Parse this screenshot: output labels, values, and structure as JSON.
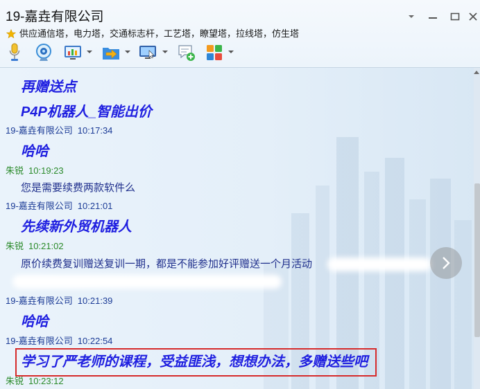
{
  "window": {
    "title": "19-嘉垚有限公司",
    "subtitle": "供应通信塔，电力塔，交通标志杆，工艺塔，瞭望塔，拉线塔，仿生塔",
    "subtitle_icon": "star-icon",
    "controls": [
      "menu-chevron-icon",
      "minimize-icon",
      "maximize-icon",
      "close-icon"
    ]
  },
  "toolbar": {
    "items": [
      {
        "icon": "microphone-icon",
        "dropdown": false
      },
      {
        "icon": "webcam-icon",
        "dropdown": false
      },
      {
        "icon": "screen-share-icon",
        "dropdown": true
      },
      {
        "icon": "file-transfer-icon",
        "dropdown": true
      },
      {
        "icon": "remote-desktop-icon",
        "dropdown": true
      },
      {
        "icon": "add-chat-icon",
        "dropdown": false
      },
      {
        "icon": "apps-grid-icon",
        "dropdown": true
      }
    ]
  },
  "chat": {
    "entries": [
      {
        "type": "message",
        "style": "bold-italic",
        "text": "再赠送点"
      },
      {
        "type": "message",
        "style": "bold-italic",
        "text": "P4P机器人_智能出价"
      },
      {
        "type": "sender",
        "is_self": false,
        "sender": "19-嘉垚有限公司",
        "time": "10:17:34"
      },
      {
        "type": "message",
        "style": "bold-italic",
        "text": "哈哈"
      },
      {
        "type": "sender",
        "is_self": true,
        "sender": "朱锐",
        "time": "10:19:23"
      },
      {
        "type": "message",
        "style": "plain",
        "text": "您是需要续费两款软件么"
      },
      {
        "type": "sender",
        "is_self": false,
        "sender": "19-嘉垚有限公司",
        "time": "10:21:01"
      },
      {
        "type": "message",
        "style": "bold-italic",
        "text": "先续新外贸机器人"
      },
      {
        "type": "sender",
        "is_self": true,
        "sender": "朱锐",
        "time": "10:21:02"
      },
      {
        "type": "message",
        "style": "plain",
        "text": "原价续费复训赠送复训一期，都是不能参加好评赠送一个月活动"
      },
      {
        "type": "sender",
        "is_self": false,
        "sender": "19-嘉垚有限公司",
        "time": "10:21:39"
      },
      {
        "type": "message",
        "style": "bold-italic",
        "text": "哈哈"
      },
      {
        "type": "sender",
        "is_self": false,
        "sender": "19-嘉垚有限公司",
        "time": "10:22:54"
      },
      {
        "type": "message",
        "style": "bold-italic",
        "highlighted": true,
        "text": "学习了严老师的课程，受益匪浅，想想办法，多赠送些吧"
      },
      {
        "type": "sender",
        "is_self": true,
        "sender": "朱锐",
        "time": "10:23:12"
      }
    ],
    "next_icon": "chevron-right-icon",
    "scroll_icon": "scroll-up-icon"
  },
  "colors": {
    "sender_other": "#1b3b96",
    "sender_self": "#2a8a2a",
    "message_bold": "#1f1fe0",
    "message_plain": "#1f2f8c",
    "highlight_border": "#d62a2a",
    "star": "#f2b400"
  }
}
